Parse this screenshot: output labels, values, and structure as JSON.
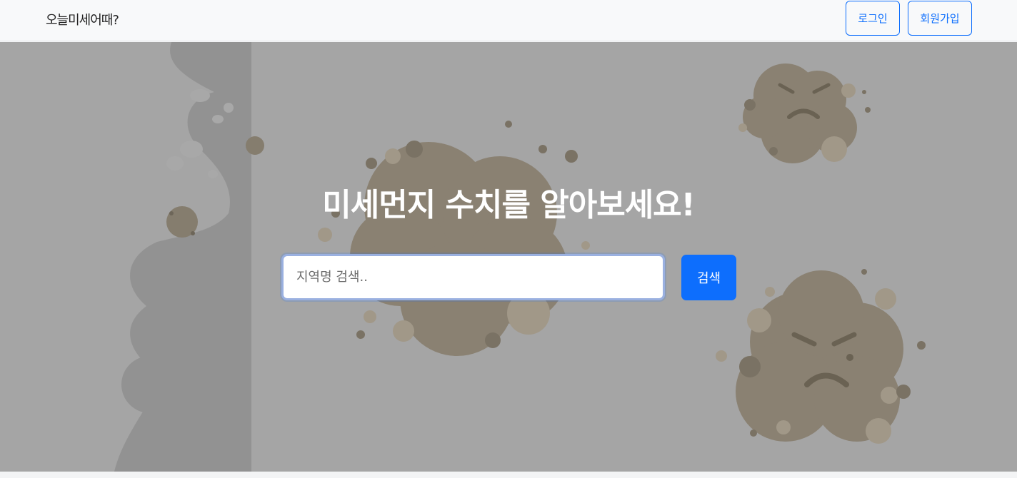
{
  "navbar": {
    "brand": "오늘미세어때?",
    "login_label": "로그인",
    "signup_label": "회원가입"
  },
  "hero": {
    "title": "미세먼지 수치를 알아보세요!",
    "search_placeholder": "지역명 검색..",
    "search_button_label": "검색",
    "background_color": "#a5a5a5",
    "illustration": "angry-dust-cloud-icons"
  },
  "colors": {
    "primary": "#0d6efd",
    "navbar_bg": "#f8f9fa",
    "dust": "#8a8172"
  }
}
